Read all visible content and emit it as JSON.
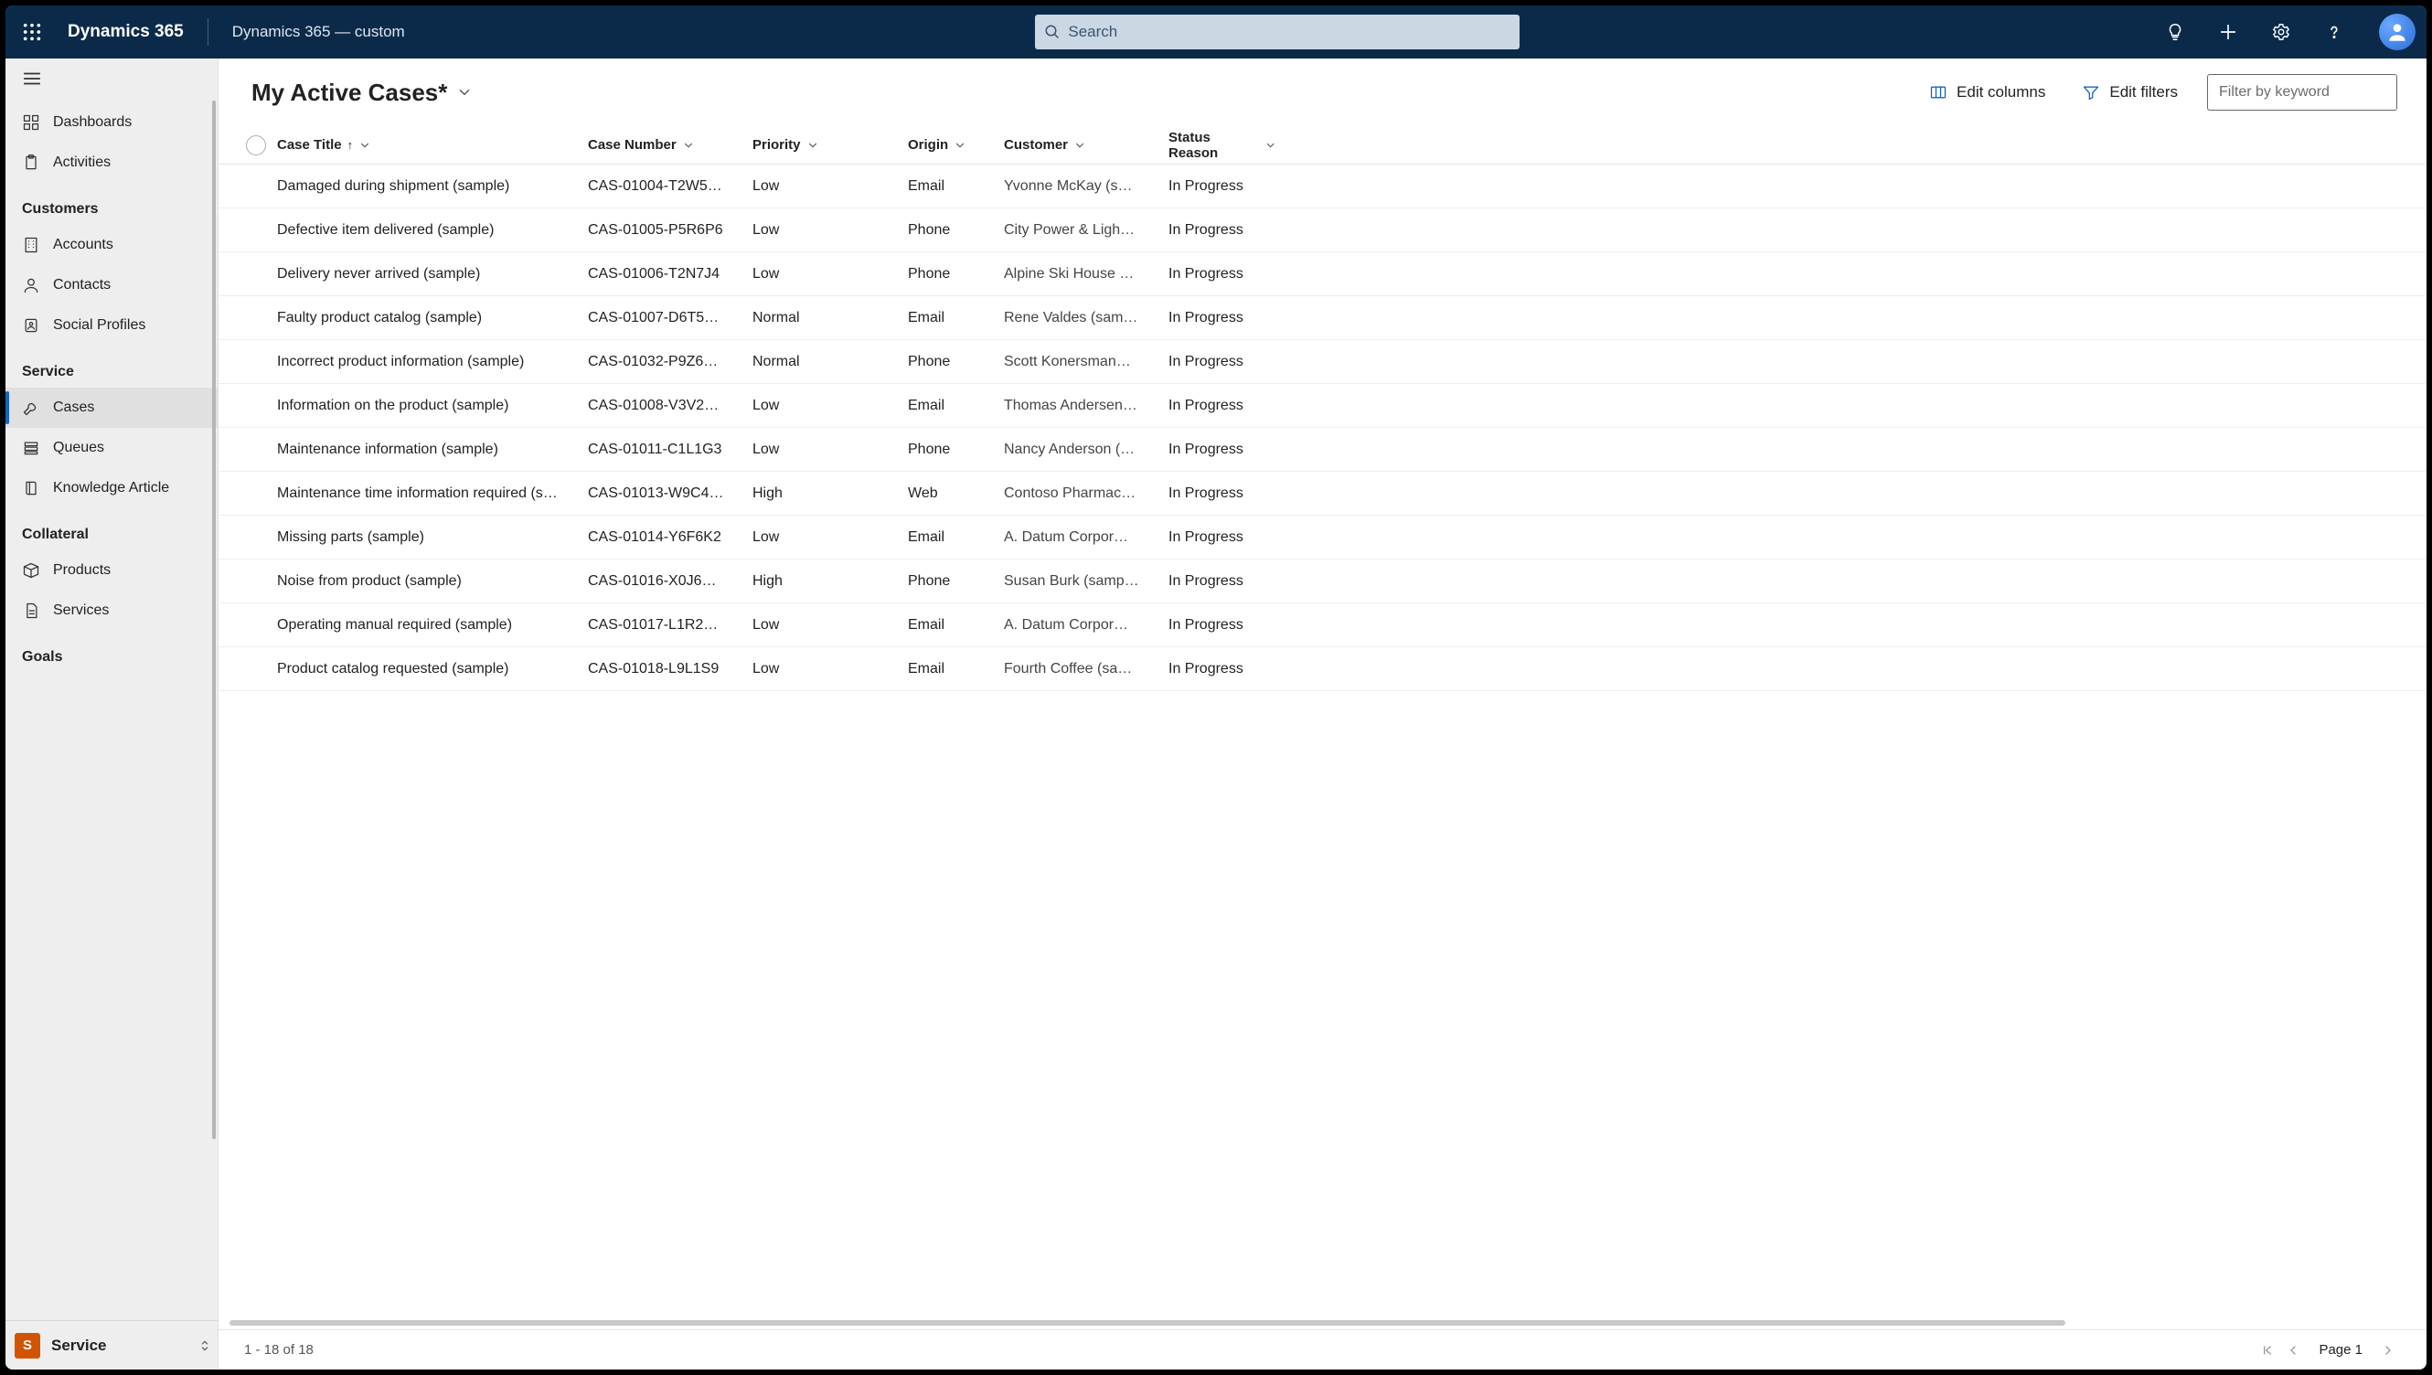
{
  "topbar": {
    "brand": "Dynamics 365",
    "breadcrumb": "Dynamics 365 — custom",
    "search_placeholder": "Search"
  },
  "sidebar": {
    "top_items": [
      {
        "id": "dashboards",
        "label": "Dashboards",
        "icon": "dashboard"
      },
      {
        "id": "activities",
        "label": "Activities",
        "icon": "clipboard"
      }
    ],
    "groups": [
      {
        "label": "Customers",
        "items": [
          {
            "id": "accounts",
            "label": "Accounts",
            "icon": "building"
          },
          {
            "id": "contacts",
            "label": "Contacts",
            "icon": "person"
          },
          {
            "id": "social-profiles",
            "label": "Social Profiles",
            "icon": "badge"
          }
        ]
      },
      {
        "label": "Service",
        "items": [
          {
            "id": "cases",
            "label": "Cases",
            "icon": "wrench",
            "active": true
          },
          {
            "id": "queues",
            "label": "Queues",
            "icon": "queue"
          },
          {
            "id": "knowledge-article",
            "label": "Knowledge Article",
            "icon": "book"
          }
        ]
      },
      {
        "label": "Collateral",
        "items": [
          {
            "id": "products",
            "label": "Products",
            "icon": "box"
          },
          {
            "id": "services",
            "label": "Services",
            "icon": "doc"
          }
        ]
      },
      {
        "label": "Goals",
        "items": []
      }
    ],
    "footer": {
      "tile_letter": "S",
      "label": "Service"
    }
  },
  "view": {
    "title": "My Active Cases*",
    "edit_columns_label": "Edit columns",
    "edit_filters_label": "Edit filters",
    "filter_placeholder": "Filter by keyword"
  },
  "grid": {
    "columns": [
      {
        "key": "title",
        "label": "Case Title",
        "sorted": "asc"
      },
      {
        "key": "case_number",
        "label": "Case Number"
      },
      {
        "key": "priority",
        "label": "Priority"
      },
      {
        "key": "origin",
        "label": "Origin"
      },
      {
        "key": "customer",
        "label": "Customer"
      },
      {
        "key": "status_reason",
        "label": "Status Reason"
      }
    ],
    "rows": [
      {
        "title": "Damaged during shipment (sample)",
        "case_number": "CAS-01004-T2W5…",
        "priority": "Low",
        "origin": "Email",
        "customer": "Yvonne McKay (s…",
        "status_reason": "In Progress"
      },
      {
        "title": "Defective item delivered (sample)",
        "case_number": "CAS-01005-P5R6P6",
        "priority": "Low",
        "origin": "Phone",
        "customer": "City Power & Ligh…",
        "status_reason": "In Progress"
      },
      {
        "title": "Delivery never arrived (sample)",
        "case_number": "CAS-01006-T2N7J4",
        "priority": "Low",
        "origin": "Phone",
        "customer": "Alpine Ski House …",
        "status_reason": "In Progress"
      },
      {
        "title": "Faulty product catalog (sample)",
        "case_number": "CAS-01007-D6T5…",
        "priority": "Normal",
        "origin": "Email",
        "customer": "Rene Valdes (sam…",
        "status_reason": "In Progress"
      },
      {
        "title": "Incorrect product information (sample)",
        "case_number": "CAS-01032-P9Z6…",
        "priority": "Normal",
        "origin": "Phone",
        "customer": "Scott Konersman…",
        "status_reason": "In Progress"
      },
      {
        "title": "Information on the product (sample)",
        "case_number": "CAS-01008-V3V2…",
        "priority": "Low",
        "origin": "Email",
        "customer": "Thomas Andersen…",
        "status_reason": "In Progress"
      },
      {
        "title": "Maintenance information (sample)",
        "case_number": "CAS-01011-C1L1G3",
        "priority": "Low",
        "origin": "Phone",
        "customer": "Nancy Anderson (…",
        "status_reason": "In Progress"
      },
      {
        "title": "Maintenance time information required (s…",
        "case_number": "CAS-01013-W9C4…",
        "priority": "High",
        "origin": "Web",
        "customer": "Contoso Pharmac…",
        "status_reason": "In Progress"
      },
      {
        "title": "Missing parts (sample)",
        "case_number": "CAS-01014-Y6F6K2",
        "priority": "Low",
        "origin": "Email",
        "customer": "A. Datum Corpor…",
        "status_reason": "In Progress"
      },
      {
        "title": "Noise from product (sample)",
        "case_number": "CAS-01016-X0J6…",
        "priority": "High",
        "origin": "Phone",
        "customer": "Susan Burk (samp…",
        "status_reason": "In Progress"
      },
      {
        "title": "Operating manual required (sample)",
        "case_number": "CAS-01017-L1R2…",
        "priority": "Low",
        "origin": "Email",
        "customer": "A. Datum Corpor…",
        "status_reason": "In Progress"
      },
      {
        "title": "Product catalog requested (sample)",
        "case_number": "CAS-01018-L9L1S9",
        "priority": "Low",
        "origin": "Email",
        "customer": "Fourth Coffee (sa…",
        "status_reason": "In Progress"
      }
    ]
  },
  "pager": {
    "range_text": "1 - 18 of 18",
    "page_text": "Page 1"
  }
}
